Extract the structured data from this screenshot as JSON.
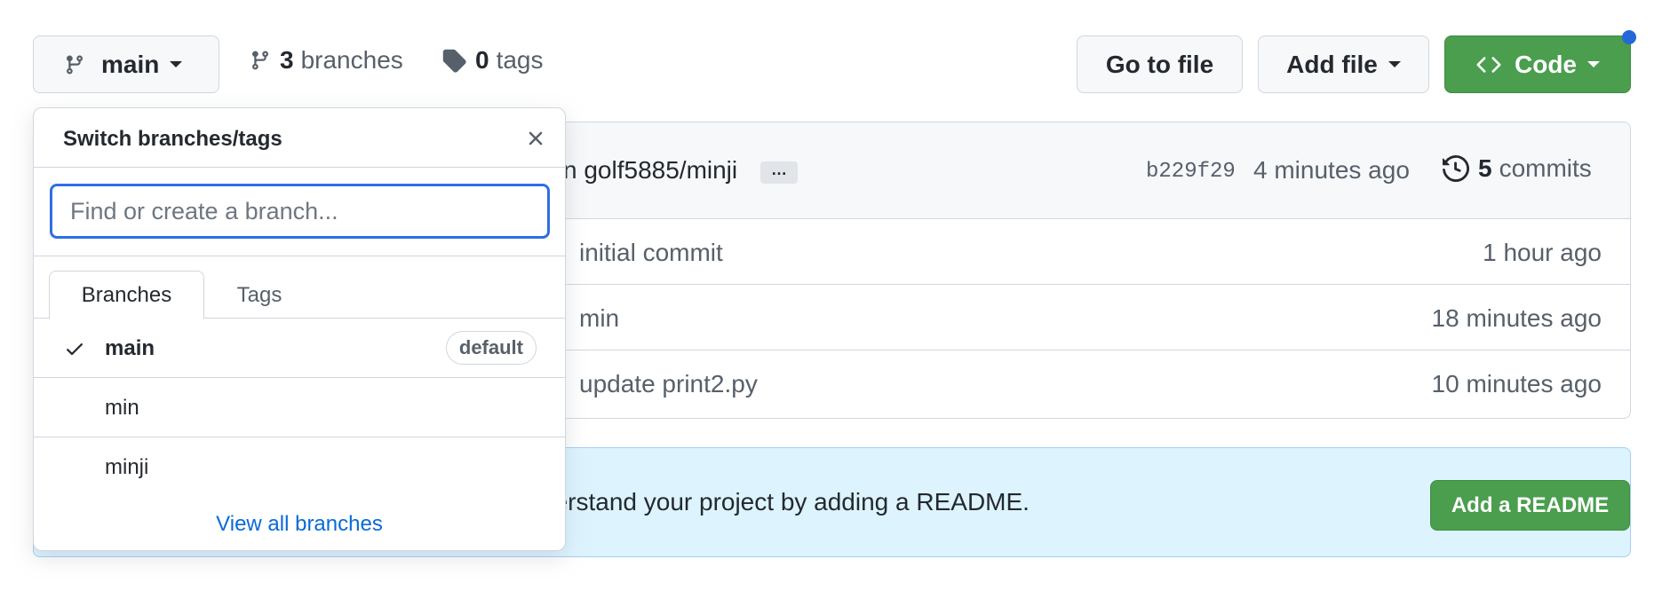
{
  "toolbar": {
    "branch_name": "main",
    "branches_count": "3",
    "branches_label": "branches",
    "tags_count": "0",
    "tags_label": "tags",
    "goto_label": "Go to file",
    "add_file_label": "Add file",
    "code_label": "Code"
  },
  "commit": {
    "branch_text": "n golf5885/minji",
    "ellipsis": "…",
    "hash": "b229f29",
    "time": "4 minutes ago",
    "count": "5",
    "count_label": "commits"
  },
  "files": [
    {
      "message": "initial commit",
      "time": "1 hour ago"
    },
    {
      "message": "min",
      "time": "18 minutes ago"
    },
    {
      "message": "update print2.py",
      "time": "10 minutes ago"
    }
  ],
  "readme": {
    "text": "derstand your project by adding a README.",
    "button": "Add a README"
  },
  "branch_menu": {
    "title": "Switch branches/tags",
    "search_placeholder": "Find or create a branch...",
    "tabs": [
      "Branches",
      "Tags"
    ],
    "items": [
      {
        "name": "main",
        "badge": "default",
        "selected": true
      },
      {
        "name": "min"
      },
      {
        "name": "minji"
      }
    ],
    "view_all": "View all branches"
  },
  "colors": {
    "primary_green": "#4a9e4e",
    "link_blue": "#0969da",
    "focus_blue": "#2f6ee0",
    "banner_bg": "#ddf4ff",
    "notification_dot": "#2468d8"
  }
}
